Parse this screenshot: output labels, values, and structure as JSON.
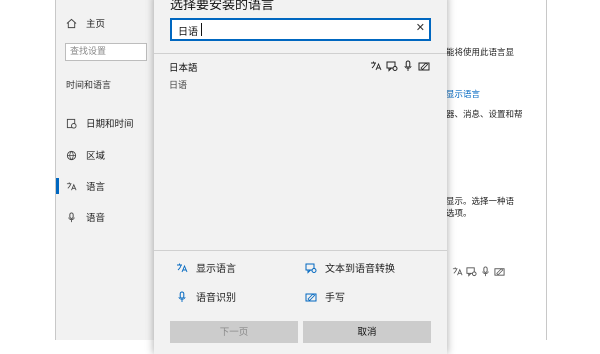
{
  "settings": {
    "nav": {
      "home": "主页",
      "search_placeholder": "查找设置",
      "section": "时间和语言",
      "items": [
        "日期和时间",
        "区域",
        "语言",
        "语音"
      ]
    },
    "right_lines": [
      {
        "text": "能将使用此语言显",
        "link": false
      },
      {
        "text": "显示语言",
        "link": true
      },
      {
        "text": "器、消息、设置和帮",
        "link": false
      },
      {
        "text": "显示。选择一种语",
        "link": false
      },
      {
        "text": "选项。",
        "link": false
      }
    ]
  },
  "dialog": {
    "title": "选择要安装的语言",
    "search": {
      "value": "日语"
    },
    "result": {
      "name": "日本語",
      "subtitle": "日语"
    },
    "legend": {
      "display_language": "显示语言",
      "text_to_speech": "文本到语音转换",
      "speech_recognition": "语音识别",
      "handwriting": "手写"
    },
    "buttons": {
      "next": "下一页",
      "cancel": "取消"
    }
  },
  "icons": [
    "home-icon",
    "clock-icon",
    "globe-icon",
    "language-icon",
    "microphone-icon",
    "display-language-icon",
    "text-to-speech-icon",
    "speech-recognition-icon",
    "handwriting-icon",
    "close-icon"
  ]
}
